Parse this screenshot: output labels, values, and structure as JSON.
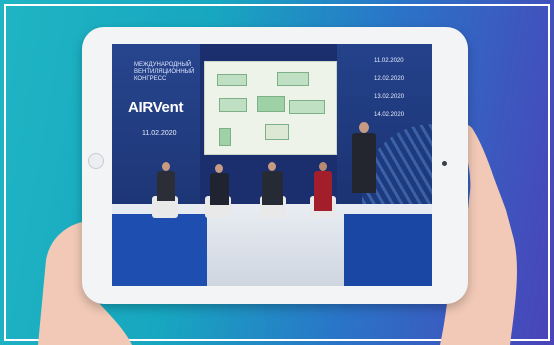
{
  "conference": {
    "title_lines": [
      "МЕЖДУНАРОДНЫЙ",
      "ВЕНТИЛЯЦИОННЫЙ",
      "КОНГРЕСС"
    ],
    "logo": "AIRVent",
    "date": "11.02.2020"
  },
  "schedule_dates": [
    "11.02.2020",
    "12.02.2020",
    "13.02.2020",
    "14.02.2020"
  ],
  "colors": {
    "background_start": "#1fb5c4",
    "background_end": "#4a43b8",
    "stage_blue": "#1e4fb0"
  }
}
